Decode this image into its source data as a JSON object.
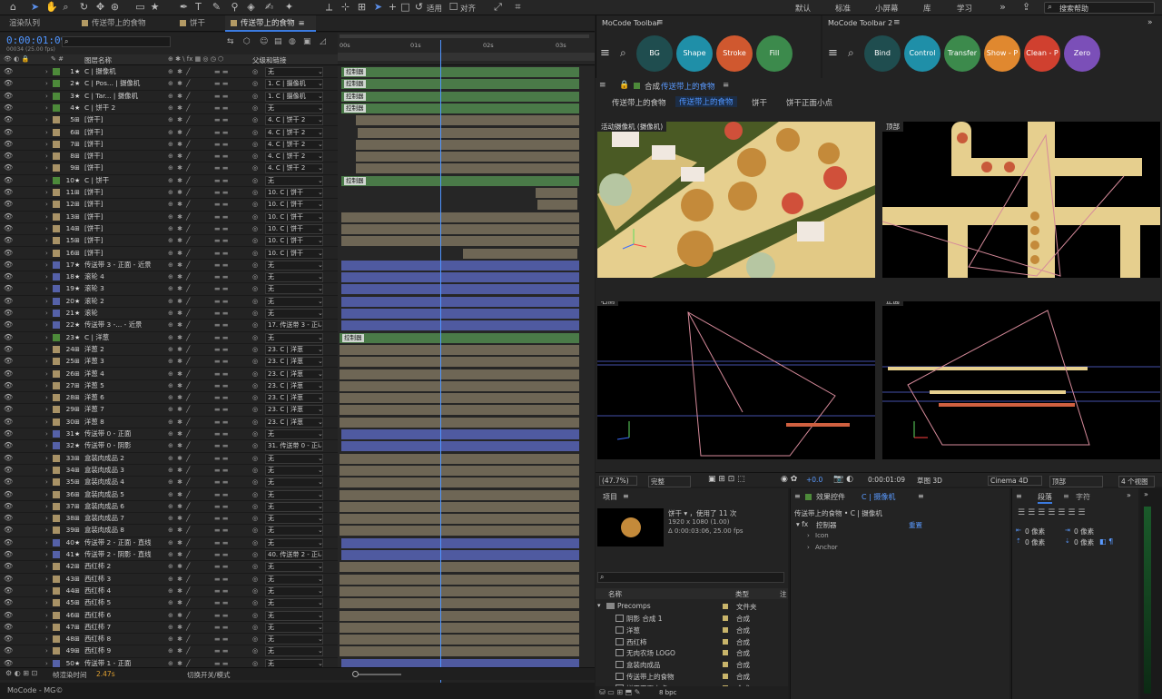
{
  "topbar": {
    "workspaces": [
      "默认",
      "标准",
      "小屏幕",
      "库",
      "学习"
    ],
    "search_placeholder": "搜索帮助",
    "align_label": "对齐",
    "apply_label": "适用"
  },
  "tabs": [
    {
      "label": "渲染队列"
    },
    {
      "label": "传送带上的食物"
    },
    {
      "label": "饼干"
    },
    {
      "label": "传送带上的食物",
      "active": true
    }
  ],
  "timeline": {
    "timecode": "0:00:01:09",
    "timecode_sub": "00034 (25.00 fps)",
    "col_name": "图层名称",
    "col_parent": "父级和链接",
    "ruler": [
      "00s",
      "01s",
      "02s",
      "03s"
    ],
    "footer_left": "帧渲染时间",
    "footer_time": "2.47s",
    "footer_mid": "切换开关/模式",
    "status": "MoCode - MG©"
  },
  "layers": [
    {
      "n": 1,
      "name": "C | 摄像机",
      "color": "#4d8a3a",
      "star": true,
      "par": "无",
      "bar": "#4a7a48",
      "ctrl": true
    },
    {
      "n": 2,
      "name": "C | Pos... | 摄像机",
      "color": "#4d8a3a",
      "star": true,
      "par": "1. C | 摄像机",
      "bar": "#4a7a48",
      "ctrl": true
    },
    {
      "n": 3,
      "name": "C | Tar... | 摄像机",
      "color": "#4d8a3a",
      "star": true,
      "par": "1. C | 摄像机",
      "bar": "#4a7a48",
      "ctrl": true
    },
    {
      "n": 4,
      "name": "C | 饼干 2",
      "color": "#4d8a3a",
      "star": true,
      "par": "无",
      "bar": "#4a7a48",
      "ctrl": true
    },
    {
      "n": 5,
      "name": "[饼干]",
      "color": "#a89266",
      "par": "4. C | 饼干 2",
      "bar": "#6e6655"
    },
    {
      "n": 6,
      "name": "[饼干]",
      "color": "#a89266",
      "par": "4. C | 饼干 2",
      "bar": "#6e6655"
    },
    {
      "n": 7,
      "name": "[饼干]",
      "color": "#a89266",
      "par": "4. C | 饼干 2",
      "bar": "#6e6655"
    },
    {
      "n": 8,
      "name": "[饼干]",
      "color": "#a89266",
      "par": "4. C | 饼干 2",
      "bar": "#6e6655"
    },
    {
      "n": 9,
      "name": "[饼干]",
      "color": "#a89266",
      "par": "4. C | 饼干 2",
      "bar": "#6e6655"
    },
    {
      "n": 10,
      "name": "C | 饼干",
      "color": "#4d8a3a",
      "star": true,
      "par": "无",
      "bar": "#4a7a48",
      "ctrl": true
    },
    {
      "n": 11,
      "name": "[饼干]",
      "color": "#a89266",
      "par": "10. C | 饼干",
      "bar": "#6e6655"
    },
    {
      "n": 12,
      "name": "[饼干]",
      "color": "#a89266",
      "par": "10. C | 饼干",
      "bar": "#6e6655"
    },
    {
      "n": 13,
      "name": "[饼干]",
      "color": "#a89266",
      "par": "10. C | 饼干",
      "bar": "#6e6655"
    },
    {
      "n": 14,
      "name": "[饼干]",
      "color": "#a89266",
      "par": "10. C | 饼干",
      "bar": "#6e6655"
    },
    {
      "n": 15,
      "name": "[饼干]",
      "color": "#a89266",
      "par": "10. C | 饼干",
      "bar": "#6e6655"
    },
    {
      "n": 16,
      "name": "[饼干]",
      "color": "#a89266",
      "par": "10. C | 饼干",
      "bar": "#6e6655"
    },
    {
      "n": 17,
      "name": "传送带 3 - 正面 - 近景",
      "color": "#5561a8",
      "star": true,
      "par": "无",
      "bar": "#4f5aa0"
    },
    {
      "n": 18,
      "name": "滚轮 4",
      "color": "#5561a8",
      "star": true,
      "par": "无",
      "bar": "#4f5aa0"
    },
    {
      "n": 19,
      "name": "滚轮 3",
      "color": "#5561a8",
      "star": true,
      "par": "无",
      "bar": "#4f5aa0"
    },
    {
      "n": 20,
      "name": "滚轮 2",
      "color": "#5561a8",
      "star": true,
      "par": "无",
      "bar": "#4f5aa0"
    },
    {
      "n": 21,
      "name": "滚轮",
      "color": "#5561a8",
      "star": true,
      "par": "无",
      "bar": "#4f5aa0"
    },
    {
      "n": 22,
      "name": "传送带 3 -... - 近景",
      "color": "#5561a8",
      "star": true,
      "par": "17. 传送带 3 - 正i",
      "bar": "#4f5aa0"
    },
    {
      "n": 23,
      "name": "C | 洋葱",
      "color": "#4d8a3a",
      "star": true,
      "par": "无",
      "bar": "#4a7a48",
      "ctrl": true
    },
    {
      "n": 24,
      "name": "洋葱 2",
      "color": "#a89266",
      "par": "23. C | 洋葱",
      "bar": "#6e6655"
    },
    {
      "n": 25,
      "name": "洋葱 3",
      "color": "#a89266",
      "par": "23. C | 洋葱",
      "bar": "#6e6655"
    },
    {
      "n": 26,
      "name": "洋葱 4",
      "color": "#a89266",
      "par": "23. C | 洋葱",
      "bar": "#6e6655"
    },
    {
      "n": 27,
      "name": "洋葱 5",
      "color": "#a89266",
      "par": "23. C | 洋葱",
      "bar": "#6e6655"
    },
    {
      "n": 28,
      "name": "洋葱 6",
      "color": "#a89266",
      "par": "23. C | 洋葱",
      "bar": "#6e6655"
    },
    {
      "n": 29,
      "name": "洋葱 7",
      "color": "#a89266",
      "par": "23. C | 洋葱",
      "bar": "#6e6655"
    },
    {
      "n": 30,
      "name": "洋葱 8",
      "color": "#a89266",
      "par": "23. C | 洋葱",
      "bar": "#6e6655"
    },
    {
      "n": 31,
      "name": "传送带 0 - 正面",
      "color": "#5561a8",
      "star": true,
      "par": "无",
      "bar": "#4f5aa0"
    },
    {
      "n": 32,
      "name": "传送带 0 - 阴影",
      "color": "#5561a8",
      "star": true,
      "par": "31. 传送带 0 - 正i",
      "bar": "#4f5aa0"
    },
    {
      "n": 33,
      "name": "盒装肉成品 2",
      "color": "#a89266",
      "par": "无",
      "bar": "#6e6655"
    },
    {
      "n": 34,
      "name": "盒装肉成品 3",
      "color": "#a89266",
      "par": "无",
      "bar": "#6e6655"
    },
    {
      "n": 35,
      "name": "盒装肉成品 4",
      "color": "#a89266",
      "par": "无",
      "bar": "#6e6655"
    },
    {
      "n": 36,
      "name": "盒装肉成品 5",
      "color": "#a89266",
      "par": "无",
      "bar": "#6e6655"
    },
    {
      "n": 37,
      "name": "盒装肉成品 6",
      "color": "#a89266",
      "par": "无",
      "bar": "#6e6655"
    },
    {
      "n": 38,
      "name": "盒装肉成品 7",
      "color": "#a89266",
      "par": "无",
      "bar": "#6e6655"
    },
    {
      "n": 39,
      "name": "盒装肉成品 8",
      "color": "#a89266",
      "par": "无",
      "bar": "#6e6655"
    },
    {
      "n": 40,
      "name": "传送带 2 - 正面 - 直线",
      "color": "#5561a8",
      "star": true,
      "par": "无",
      "bar": "#4f5aa0"
    },
    {
      "n": 41,
      "name": "传送带 2 - 阴影 - 直线",
      "color": "#5561a8",
      "star": true,
      "par": "40. 传送带 2 - 正i",
      "bar": "#4f5aa0"
    },
    {
      "n": 42,
      "name": "西红柿 2",
      "color": "#a89266",
      "par": "无",
      "bar": "#6e6655"
    },
    {
      "n": 43,
      "name": "西红柿 3",
      "color": "#a89266",
      "par": "无",
      "bar": "#6e6655"
    },
    {
      "n": 44,
      "name": "西红柿 4",
      "color": "#a89266",
      "par": "无",
      "bar": "#6e6655"
    },
    {
      "n": 45,
      "name": "西红柿 5",
      "color": "#a89266",
      "par": "无",
      "bar": "#6e6655"
    },
    {
      "n": 46,
      "name": "西红柿 6",
      "color": "#a89266",
      "par": "无",
      "bar": "#6e6655"
    },
    {
      "n": 47,
      "name": "西红柿 7",
      "color": "#a89266",
      "par": "无",
      "bar": "#6e6655"
    },
    {
      "n": 48,
      "name": "西红柿 8",
      "color": "#a89266",
      "par": "无",
      "bar": "#6e6655"
    },
    {
      "n": 49,
      "name": "西红柿 9",
      "color": "#a89266",
      "par": "无",
      "bar": "#6e6655"
    },
    {
      "n": 50,
      "name": "传送带 1 - 正面",
      "color": "#5561a8",
      "star": true,
      "par": "无",
      "bar": "#4f5aa0"
    }
  ],
  "controller_label": "控制器",
  "moco1": {
    "title": "MoCode Toolbar",
    "buttons": [
      {
        "label": "BG",
        "color": "#1f4d4f"
      },
      {
        "label": "Shape",
        "color": "#1f8fa8"
      },
      {
        "label": "Stroke",
        "color": "#d0582f"
      },
      {
        "label": "Fill",
        "color": "#3c8a4c"
      }
    ]
  },
  "moco2": {
    "title": "MoCode Toolbar 2",
    "buttons": [
      {
        "label": "Bind",
        "color": "#1f4d4f"
      },
      {
        "label": "Control",
        "color": "#1f8fa8"
      },
      {
        "label": "Transfer",
        "color": "#3c8a4c"
      },
      {
        "label": "Show - P",
        "color": "#e0882f"
      },
      {
        "label": "Clean - P",
        "color": "#d0402f"
      },
      {
        "label": "Zero",
        "color": "#7b4fb8"
      }
    ]
  },
  "comp": {
    "title_prefix": "合成",
    "title": "传送带上的食物",
    "crumbs": [
      "传送带上的食物",
      "传送带上的食物",
      "饼干",
      "饼干正面小点"
    ],
    "views": [
      "活动摄像机 (摄像机)",
      "顶部",
      "右侧",
      "正面"
    ]
  },
  "compbar": {
    "zoom": "(47.7%)",
    "quality": "完整",
    "exposure": "+0.0",
    "time": "0:00:01:09",
    "draft": "草图 3D",
    "renderer": "Cinema 4D",
    "view": "顶部",
    "layout": "4 个视图"
  },
  "project": {
    "title": "项目",
    "item_name": "饼干 ▾ ，使用了 11 次",
    "item_size": "1920 x 1080 (1.00)",
    "item_dur": "Δ 0:00:03:06, 25.00 fps",
    "col_name": "名称",
    "col_type": "类型",
    "col_note": "注",
    "folder": "Precomps",
    "folder_type": "文件夹",
    "items": [
      {
        "name": "阴影 合成 1",
        "type": "合成"
      },
      {
        "name": "洋葱",
        "type": "合成"
      },
      {
        "name": "西红柿",
        "type": "合成"
      },
      {
        "name": "无肉农场 LOGO",
        "type": "合成"
      },
      {
        "name": "盒装肉成品",
        "type": "合成"
      },
      {
        "name": "传送带上的食物",
        "type": "合成"
      },
      {
        "name": "饼干正面小点",
        "type": "合成"
      }
    ],
    "bpc": "8 bpc"
  },
  "effects": {
    "title": "效果控件",
    "layer": "C | 摄像机",
    "path": "传送带上的食物 • C | 摄像机",
    "fx": "控制器",
    "reset": "重置",
    "props": [
      "Icon",
      "Anchor"
    ]
  },
  "para": {
    "tab1": "段落",
    "tab2": "字符",
    "v1": "0 像素",
    "v2": "0 像素",
    "v3": "0 像素",
    "v4": "0 像素"
  }
}
